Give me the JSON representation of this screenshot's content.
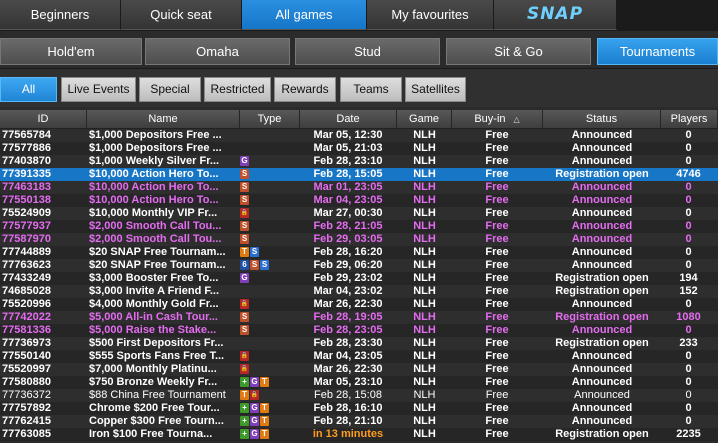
{
  "top_tabs": [
    "Beginners",
    "Quick seat",
    "All games",
    "My favourites"
  ],
  "snap_logo": "SNAP",
  "game_tabs": [
    "Hold'em",
    "Omaha",
    "Stud",
    "Sit & Go",
    "Tournaments"
  ],
  "filters": [
    "All",
    "Live Events",
    "Special",
    "Restricted",
    "Rewards",
    "Teams",
    "Satellites"
  ],
  "columns": [
    "ID",
    "Name",
    "Type",
    "Date",
    "Game",
    "Buy-in",
    "Status",
    "Players"
  ],
  "accent": "#1876c6",
  "purple": "#e46cf0",
  "rows": [
    {
      "id": "77565784",
      "name": "$1,000 Depositors Free ...",
      "type": [],
      "date": "Mar 05, 12:30",
      "game": "NLH",
      "buyin": "Free",
      "status": "Announced",
      "players": "0"
    },
    {
      "id": "77577886",
      "name": "$1,000 Depositors Free ...",
      "type": [],
      "date": "Mar 05, 21:03",
      "game": "NLH",
      "buyin": "Free",
      "status": "Announced",
      "players": "0"
    },
    {
      "id": "77403870",
      "name": "$1,000 Weekly Silver Fr...",
      "type": [
        "G"
      ],
      "date": "Feb 28, 23:10",
      "game": "NLH",
      "buyin": "Free",
      "status": "Announced",
      "players": "0"
    },
    {
      "id": "77391335",
      "name": "$10,000 Action Hero To...",
      "type": [
        "S"
      ],
      "date": "Feb 28, 15:05",
      "game": "NLH",
      "buyin": "Free",
      "status": "Registration open",
      "players": "4746",
      "selected": true
    },
    {
      "id": "77463183",
      "name": "$10,000 Action Hero To...",
      "type": [
        "S"
      ],
      "date": "Mar 01, 23:05",
      "game": "NLH",
      "buyin": "Free",
      "status": "Announced",
      "players": "0",
      "purple": true
    },
    {
      "id": "77550138",
      "name": "$10,000 Action Hero To...",
      "type": [
        "S"
      ],
      "date": "Mar 04, 23:05",
      "game": "NLH",
      "buyin": "Free",
      "status": "Announced",
      "players": "0",
      "purple": true
    },
    {
      "id": "75524909",
      "name": "$10,000 Monthly VIP Fr...",
      "type": [
        "lock"
      ],
      "date": "Mar 27, 00:30",
      "game": "NLH",
      "buyin": "Free",
      "status": "Announced",
      "players": "0"
    },
    {
      "id": "77577937",
      "name": "$2,000 Smooth Call Tou...",
      "type": [
        "S"
      ],
      "date": "Feb 28, 21:05",
      "game": "NLH",
      "buyin": "Free",
      "status": "Announced",
      "players": "0",
      "purple": true
    },
    {
      "id": "77587970",
      "name": "$2,000 Smooth Call Tou...",
      "type": [
        "S"
      ],
      "date": "Feb 29, 03:05",
      "game": "NLH",
      "buyin": "Free",
      "status": "Announced",
      "players": "0",
      "purple": true
    },
    {
      "id": "77744889",
      "name": "$20 SNAP Free Tournam...",
      "type": [
        "T",
        "S2"
      ],
      "date": "Feb 28, 16:20",
      "game": "NLH",
      "buyin": "Free",
      "status": "Announced",
      "players": "0"
    },
    {
      "id": "77763623",
      "name": "$20 SNAP Free Tournam...",
      "type": [
        "6",
        "S",
        "S2"
      ],
      "date": "Feb 29, 06:20",
      "game": "NLH",
      "buyin": "Free",
      "status": "Announced",
      "players": "0"
    },
    {
      "id": "77433249",
      "name": "$3,000 Booster Free To...",
      "type": [
        "G"
      ],
      "date": "Feb 29, 23:02",
      "game": "NLH",
      "buyin": "Free",
      "status": "Registration open",
      "players": "194"
    },
    {
      "id": "74685028",
      "name": "$3,000 Invite A Friend F...",
      "type": [],
      "date": "Mar 04, 23:02",
      "game": "NLH",
      "buyin": "Free",
      "status": "Registration open",
      "players": "152"
    },
    {
      "id": "75520996",
      "name": "$4,000 Monthly Gold Fr...",
      "type": [
        "lock"
      ],
      "date": "Mar 26, 22:30",
      "game": "NLH",
      "buyin": "Free",
      "status": "Announced",
      "players": "0"
    },
    {
      "id": "77742022",
      "name": "$5,000 All-in Cash Tour...",
      "type": [
        "S"
      ],
      "date": "Feb 28, 19:05",
      "game": "NLH",
      "buyin": "Free",
      "status": "Registration open",
      "players": "1080",
      "purple": true
    },
    {
      "id": "77581336",
      "name": "$5,000 Raise the Stake...",
      "type": [
        "S"
      ],
      "date": "Feb 28, 23:05",
      "game": "NLH",
      "buyin": "Free",
      "status": "Announced",
      "players": "0",
      "purple": true
    },
    {
      "id": "77736973",
      "name": "$500 First Depositors Fr...",
      "type": [],
      "date": "Feb 28, 23:30",
      "game": "NLH",
      "buyin": "Free",
      "status": "Registration open",
      "players": "233"
    },
    {
      "id": "77550140",
      "name": "$555 Sports Fans Free T...",
      "type": [
        "lock"
      ],
      "date": "Mar 04, 23:05",
      "game": "NLH",
      "buyin": "Free",
      "status": "Announced",
      "players": "0"
    },
    {
      "id": "75520997",
      "name": "$7,000 Monthly Platinu...",
      "type": [
        "lock"
      ],
      "date": "Mar 26, 22:30",
      "game": "NLH",
      "buyin": "Free",
      "status": "Announced",
      "players": "0"
    },
    {
      "id": "77580880",
      "name": "$750 Bronze Weekly Fr...",
      "type": [
        "plus",
        "G",
        "T"
      ],
      "date": "Mar 05, 23:10",
      "game": "NLH",
      "buyin": "Free",
      "status": "Announced",
      "players": "0"
    },
    {
      "id": "77736372",
      "name": "$88 China Free Tournament",
      "type": [
        "T",
        "lock"
      ],
      "date": "Feb 28, 15:08",
      "game": "NLH",
      "buyin": "Free",
      "status": "Announced",
      "players": "0",
      "light": true
    },
    {
      "id": "77757892",
      "name": "Chrome $200 Free Tour...",
      "type": [
        "plus",
        "G",
        "T"
      ],
      "date": "Feb 28, 16:10",
      "game": "NLH",
      "buyin": "Free",
      "status": "Announced",
      "players": "0"
    },
    {
      "id": "77762415",
      "name": "Copper $300 Free Tourn...",
      "type": [
        "plus",
        "G",
        "T"
      ],
      "date": "Feb 28, 21:10",
      "game": "NLH",
      "buyin": "Free",
      "status": "Announced",
      "players": "0"
    },
    {
      "id": "77763085",
      "name": "Iron $100 Free Tourna...",
      "type": [
        "plus",
        "G",
        "T"
      ],
      "date": "in 13 minutes",
      "date_orange": true,
      "game": "NLH",
      "buyin": "Free",
      "status": "Registration open",
      "players": "2235"
    }
  ]
}
